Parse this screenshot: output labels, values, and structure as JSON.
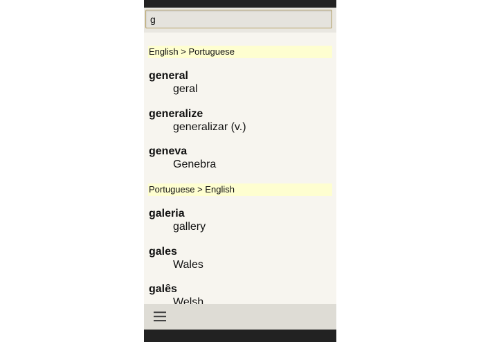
{
  "search": {
    "value": "g",
    "placeholder": ""
  },
  "sections": [
    {
      "header": "English > Portuguese",
      "entries": [
        {
          "term": "general",
          "translation": "geral"
        },
        {
          "term": "generalize",
          "translation": "generalizar (v.)"
        },
        {
          "term": "geneva",
          "translation": "Genebra"
        }
      ]
    },
    {
      "header": "Portuguese > English",
      "entries": [
        {
          "term": "galeria",
          "translation": "gallery"
        },
        {
          "term": "gales",
          "translation": "Wales"
        },
        {
          "term": "galês",
          "translation": "Welsh"
        }
      ]
    }
  ],
  "toolbar": {
    "menu_icon": "hamburger-menu-icon"
  },
  "colors": {
    "background": "#f7f5ef",
    "section_header_bg": "#fefed0",
    "toolbar_bg": "#dedcd5",
    "status_bar": "#222222",
    "search_border": "#b8a46a"
  }
}
